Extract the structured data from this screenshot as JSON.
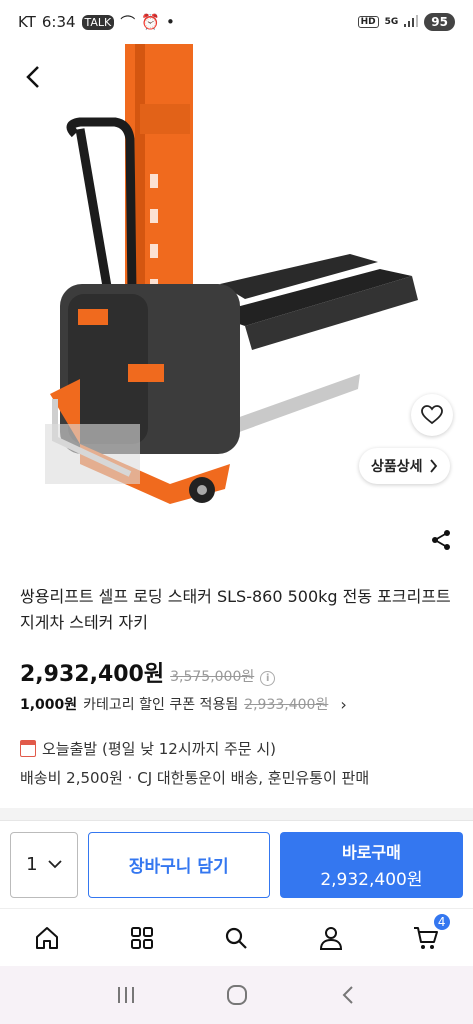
{
  "status": {
    "carrier": "KT",
    "time": "6:34",
    "talk_badge": "TALK",
    "hd_label": "HD",
    "network": "5G",
    "battery": "95"
  },
  "product": {
    "title": "쌍용리프트 셀프 로딩 스태커 SLS-860 500kg 전동 포크리프트 지게차 스테커 자키",
    "price": "2,932,400원",
    "original_price": "3,575,000원",
    "coupon_amount": "1,000원",
    "coupon_desc": "카테고리 할인 쿠폰 적용됨",
    "coupon_final": "2,933,400원",
    "shipping": "오늘출발 (평일 낮 12시까지 주문 시)",
    "fee": "배송비 2,500원 · CJ 대한통운이 배송, 훈민유통이 판매",
    "detail_button": "상품상세"
  },
  "purchase": {
    "quantity": "1",
    "cart_label": "장바구니 담기",
    "buy_label": "바로구매",
    "buy_amount": "2,932,400원"
  },
  "nav": {
    "cart_count": "4"
  },
  "colors": {
    "accent": "#3477f0",
    "lift_orange": "#f06a1e",
    "lift_body": "#3c3c3c"
  }
}
